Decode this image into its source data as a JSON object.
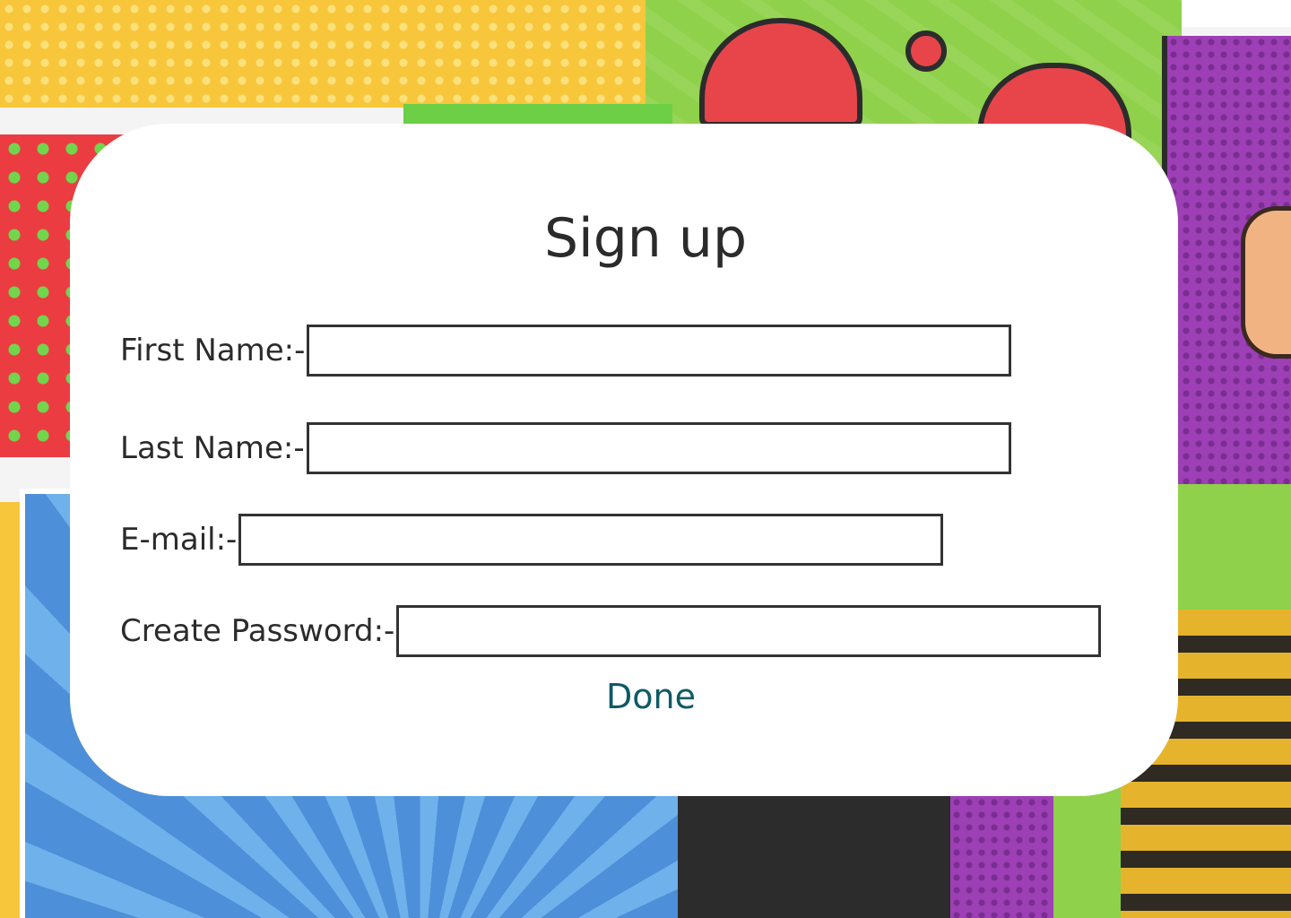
{
  "modal": {
    "title": "Sign up",
    "fields": [
      {
        "label": "First Name:-",
        "value": "",
        "placeholder": ""
      },
      {
        "label": "Last Name:-",
        "value": "",
        "placeholder": ""
      },
      {
        "label": "E-mail:-",
        "value": "",
        "placeholder": ""
      },
      {
        "label": "Create Password:-",
        "value": "",
        "placeholder": ""
      }
    ],
    "submit_label": "Done"
  },
  "colors": {
    "modal_background": "#ffffff",
    "text": "#2b2b2b",
    "input_border": "#333333",
    "done_button": "#0f5a66"
  }
}
